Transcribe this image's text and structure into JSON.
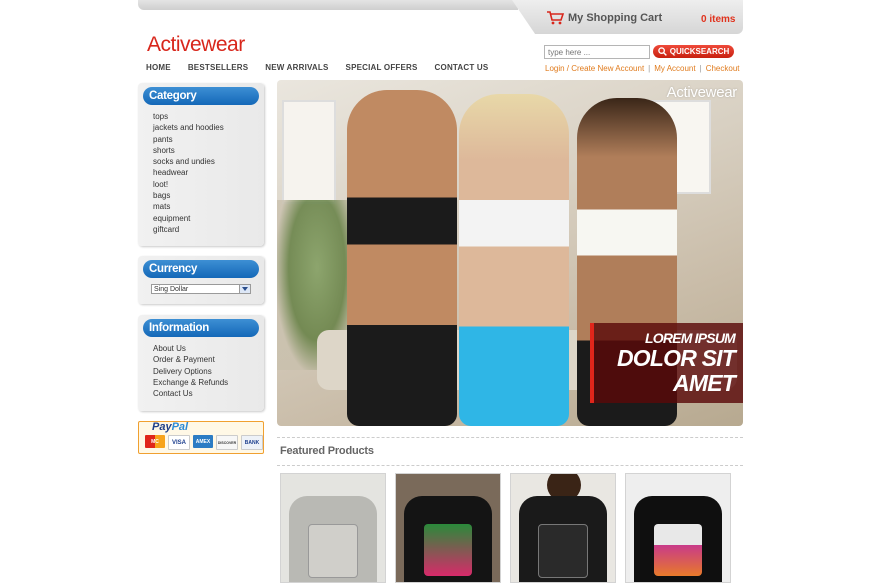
{
  "header": {
    "cart_label": "My Shopping Cart",
    "cart_items": "0 items",
    "logo_text": "Activewear",
    "search_placeholder": "type here ...",
    "quicksearch_label": "QUICKSEARCH"
  },
  "nav": {
    "items": [
      "HOME",
      "BESTSELLERS",
      "NEW ARRIVALS",
      "SPECIAL OFFERS",
      "CONTACT US"
    ]
  },
  "account": {
    "login": "Login / Create New Account",
    "my_account": "My Account",
    "checkout": "Checkout",
    "separator": "|"
  },
  "sidebar": {
    "category": {
      "title": "Category",
      "items": [
        "tops",
        "jackets and hoodies",
        "pants",
        "shorts",
        "socks and undies",
        "headwear",
        "loot!",
        "bags",
        "mats",
        "equipment",
        "giftcard"
      ]
    },
    "currency": {
      "title": "Currency",
      "selected": "Sing Dollar"
    },
    "information": {
      "title": "Information",
      "items": [
        "About Us",
        "Order & Payment",
        "Delivery Options",
        "Exchange & Refunds",
        "Contact Us"
      ]
    },
    "paypal": {
      "brand_a": "Pay",
      "brand_b": "Pal",
      "cards": [
        "MC",
        "VISA",
        "AMEX",
        "DISCOVER",
        "BANK"
      ]
    }
  },
  "banner": {
    "logo": "Activewear",
    "line1": "LOREM IPSUM",
    "line2": "DOLOR SIT",
    "line3": "AMET"
  },
  "featured": {
    "title": "Featured Products"
  },
  "colors": {
    "accent_red": "#d8261b",
    "link_orange": "#e07b1d",
    "sidebar_blue": "#1468b8"
  }
}
